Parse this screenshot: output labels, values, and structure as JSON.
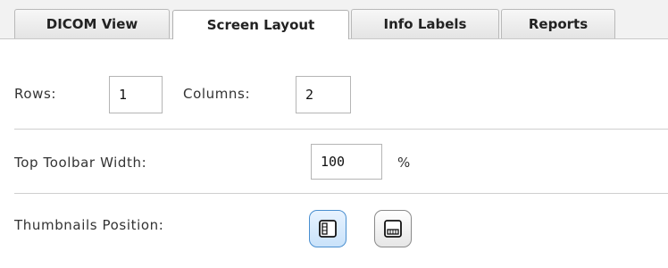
{
  "tabs": [
    {
      "label": "DICOM View"
    },
    {
      "label": "Screen Layout"
    },
    {
      "label": "Info Labels"
    },
    {
      "label": "Reports"
    }
  ],
  "layout": {
    "rows_label": "Rows:",
    "rows_value": "1",
    "columns_label": "Columns:",
    "columns_value": "2",
    "toolbar_width_label": "Top Toolbar Width:",
    "toolbar_width_value": "100",
    "toolbar_width_unit": "%",
    "thumbnails_label": "Thumbnails Position:",
    "thumbnail_positions": [
      {
        "icon": "thumbnails-left-icon",
        "selected": true
      },
      {
        "icon": "thumbnails-bottom-icon",
        "selected": false
      }
    ]
  },
  "colors": {
    "selected_border": "#4a8fd0",
    "selected_fill": "#c9e2fa"
  }
}
